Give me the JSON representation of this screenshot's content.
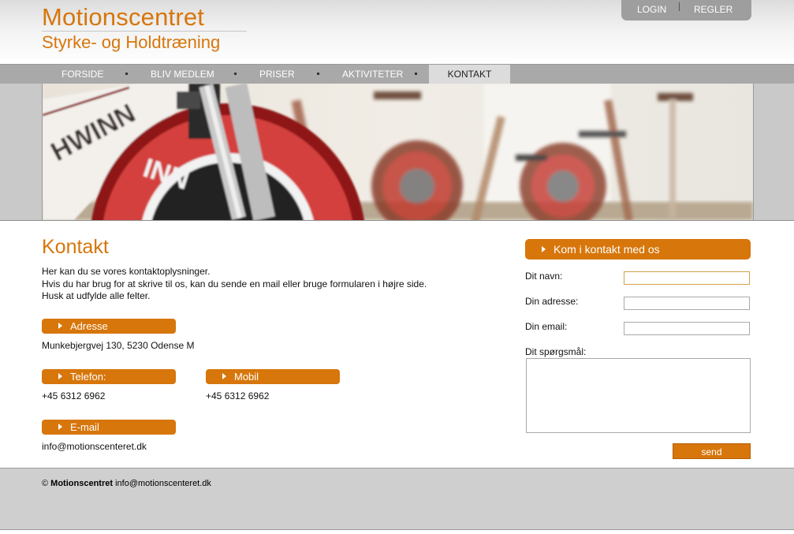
{
  "header": {
    "title": "Motionscentret",
    "subtitle": "Styrke- og Holdtræning",
    "top_links": [
      "LOGIN",
      "REGLER"
    ]
  },
  "nav": {
    "items": [
      {
        "label": "FORSIDE",
        "active": false
      },
      {
        "label": "BLIV MEDLEM",
        "active": false
      },
      {
        "label": "PRISER",
        "active": false
      },
      {
        "label": "AKTIVITETER",
        "active": false
      },
      {
        "label": "KONTAKT",
        "active": true
      }
    ]
  },
  "content": {
    "heading": "Kontakt",
    "intro": [
      "Her kan du se vores kontaktoplysninger.",
      "Hvis du har brug for at skrive til os, kan du sende en mail eller bruge formularen i højre side.",
      "Husk at udfylde alle felter."
    ],
    "address": {
      "label": "Adresse",
      "value": "Munkebjergvej 130, 5230 Odense M"
    },
    "phone": {
      "label": "Telefon:",
      "value": "+45 6312 6962"
    },
    "mobile": {
      "label": "Mobil",
      "value": "+45 6312 6962"
    },
    "email": {
      "label": "E-mail",
      "value": "info@motionscenteret.dk"
    }
  },
  "form": {
    "heading": "Kom i kontakt med os",
    "name_label": "Dit navn:",
    "address_label": "Din adresse:",
    "email_label": "Din email:",
    "question_label": "Dit spørgsmål:",
    "name_value": "",
    "address_value": "",
    "email_value": "",
    "question_value": "",
    "send_label": "send"
  },
  "footer": {
    "copyright": "©",
    "brand": "Motionscentret",
    "email": "info@motionscenteret.dk"
  },
  "colors": {
    "accent": "#d7760b",
    "nav_bg": "#a9a9a9",
    "footer_bg": "#cfcfcf"
  }
}
